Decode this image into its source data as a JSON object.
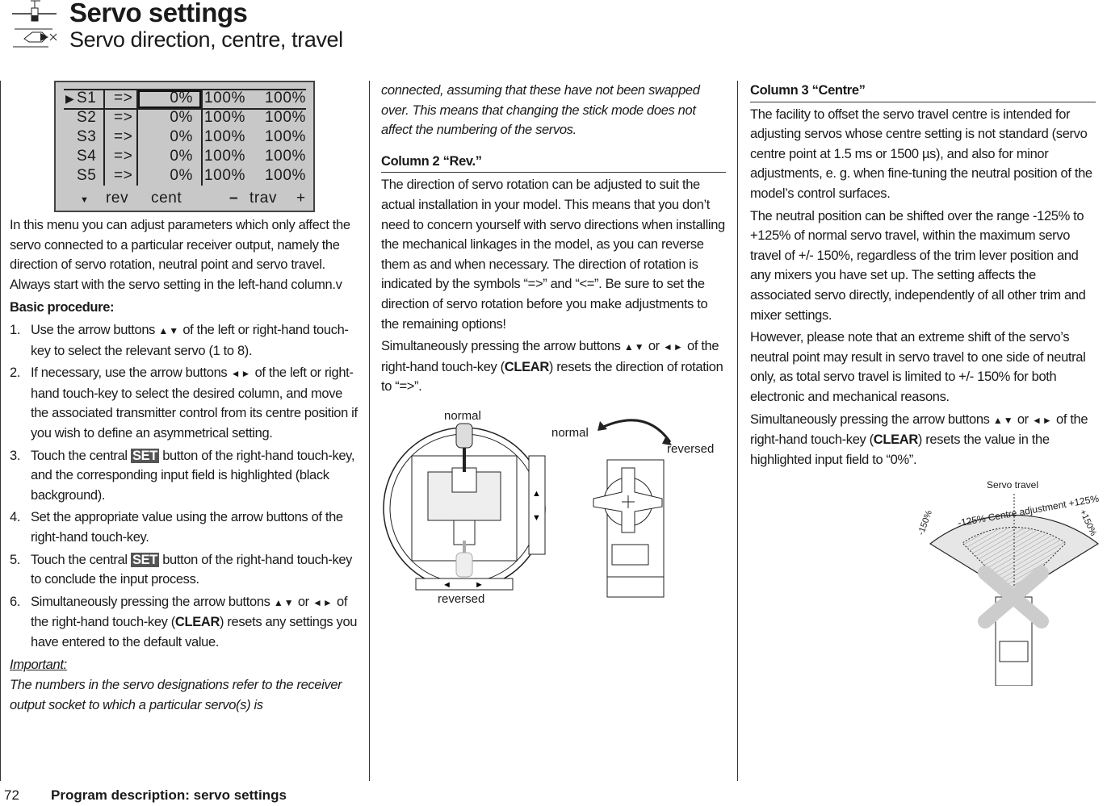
{
  "header": {
    "title": "Servo settings",
    "subtitle": "Servo direction, centre, travel",
    "icons": [
      "servo-icon",
      "helicopter-icon"
    ]
  },
  "lcd": {
    "rows": [
      {
        "servo": "S1",
        "rev": "=>",
        "cent": "0%",
        "trav_minus": "100%",
        "trav_plus": "100%",
        "selected": true
      },
      {
        "servo": "S2",
        "rev": "=>",
        "cent": "0%",
        "trav_minus": "100%",
        "trav_plus": "100%"
      },
      {
        "servo": "S3",
        "rev": "=>",
        "cent": "0%",
        "trav_minus": "100%",
        "trav_plus": "100%"
      },
      {
        "servo": "S4",
        "rev": "=>",
        "cent": "0%",
        "trav_minus": "100%",
        "trav_plus": "100%"
      },
      {
        "servo": "S5",
        "rev": "=>",
        "cent": "0%",
        "trav_minus": "100%",
        "trav_plus": "100%"
      }
    ],
    "footer": {
      "rev": "rev",
      "cent": "cent",
      "minus": "–",
      "trav": "trav",
      "plus": "+"
    }
  },
  "left": {
    "intro": "In this menu you can adjust parameters which only affect the servo connected to a particular receiver output, namely the direction of servo rotation, neutral point and servo travel. Always start with the servo setting in the left-hand column.v",
    "heading": "Basic procedure:",
    "steps": [
      {
        "n": "1.",
        "a": "Use the arrow buttons",
        "b": "of the left or right-hand touch-key to select the relevant servo (1 to 8)."
      },
      {
        "n": "2.",
        "a": "If necessary, use the arrow buttons",
        "b": "of the left or right-hand touch-key to select the desired column, and move the associated transmitter control from its centre position if you wish to define an asymmetrical setting."
      },
      {
        "n": "3.",
        "a": "Touch the central",
        "set": "SET",
        "b": "button of the right-hand touch-key, and the corresponding input field is highlighted (black background)."
      },
      {
        "n": "4.",
        "a": "Set the appropriate value using the arrow buttons of the right-hand touch-key."
      },
      {
        "n": "5.",
        "a": "Touch the central",
        "set": "SET",
        "b": "button of the right-hand touch-key to conclude the input process."
      },
      {
        "n": "6.",
        "a": "Simultaneously pressing the arrow buttons",
        "or": "or",
        "b": "of the right-hand touch-key (",
        "clear": "CLEAR",
        "c": ") resets any settings you have entered to the default value."
      }
    ],
    "important_label": "Important:",
    "important": "The numbers in the servo designations refer to the receiver output socket to which a particular servo(s) is"
  },
  "middle": {
    "cont": "connected, assuming that these have not been swapped over. This means that changing the stick mode does not affect the numbering of the servos.",
    "heading": "Column 2 “Rev.”",
    "p1": "The direction of servo rotation can be adjusted to suit the actual installation in your model. This means that you don’t need to concern yourself with servo directions when installing the mechanical linkages in the model, as you can reverse them as and when necessary. The direction of rotation is indicated by the symbols “=>” and “<=”. Be sure to set the direction of servo rotation before you make adjustments to the remaining options!",
    "p2a": "Simultaneously pressing the arrow buttons",
    "p2or": "or",
    "p2b": "of the right-hand touch-key (",
    "p2clear": "CLEAR",
    "p2c": ") resets the direction of rotation to “=>”.",
    "fig_stick": {
      "top": "normal",
      "bottom": "reversed"
    },
    "fig_servo": {
      "normal": "normal",
      "reversed": "reversed"
    }
  },
  "right": {
    "heading": "Column 3 “Centre”",
    "p1": "The facility to offset the servo travel centre is intended for adjusting servos whose centre setting is not standard (servo centre point at 1.5 ms or 1500 µs), and also for minor adjustments, e. g. when fine-tuning the neutral position of the model’s control surfaces.",
    "p2": "The neutral position can be shifted over the range -125% to +125% of normal servo travel, within the maximum servo travel of +/- 150%, regardless of the trim lever position and any mixers you have set up. The setting affects the associated servo directly, independently of all other trim and mixer settings.",
    "p3": "However, please note that an extreme shift of the servo’s neutral point may result in servo travel to one side of neutral only, as total servo travel is limited to +/- 150% for both electronic and mechanical reasons.",
    "p4a": "Simultaneously pressing the arrow buttons",
    "p4or": "or",
    "p4b": "of the right-hand touch-key (",
    "p4clear": "CLEAR",
    "p4c": ") resets the value in the highlighted input field to “0%”.",
    "fig": {
      "travel": "Servo travel",
      "centre": "-125% Centre adjustment +125%",
      "min": "-150%",
      "max": "+150%"
    }
  },
  "footer": {
    "page": "72",
    "title": "Program description: servo settings"
  },
  "arrows": {
    "updown": "▲▼",
    "leftright": "◄►"
  }
}
